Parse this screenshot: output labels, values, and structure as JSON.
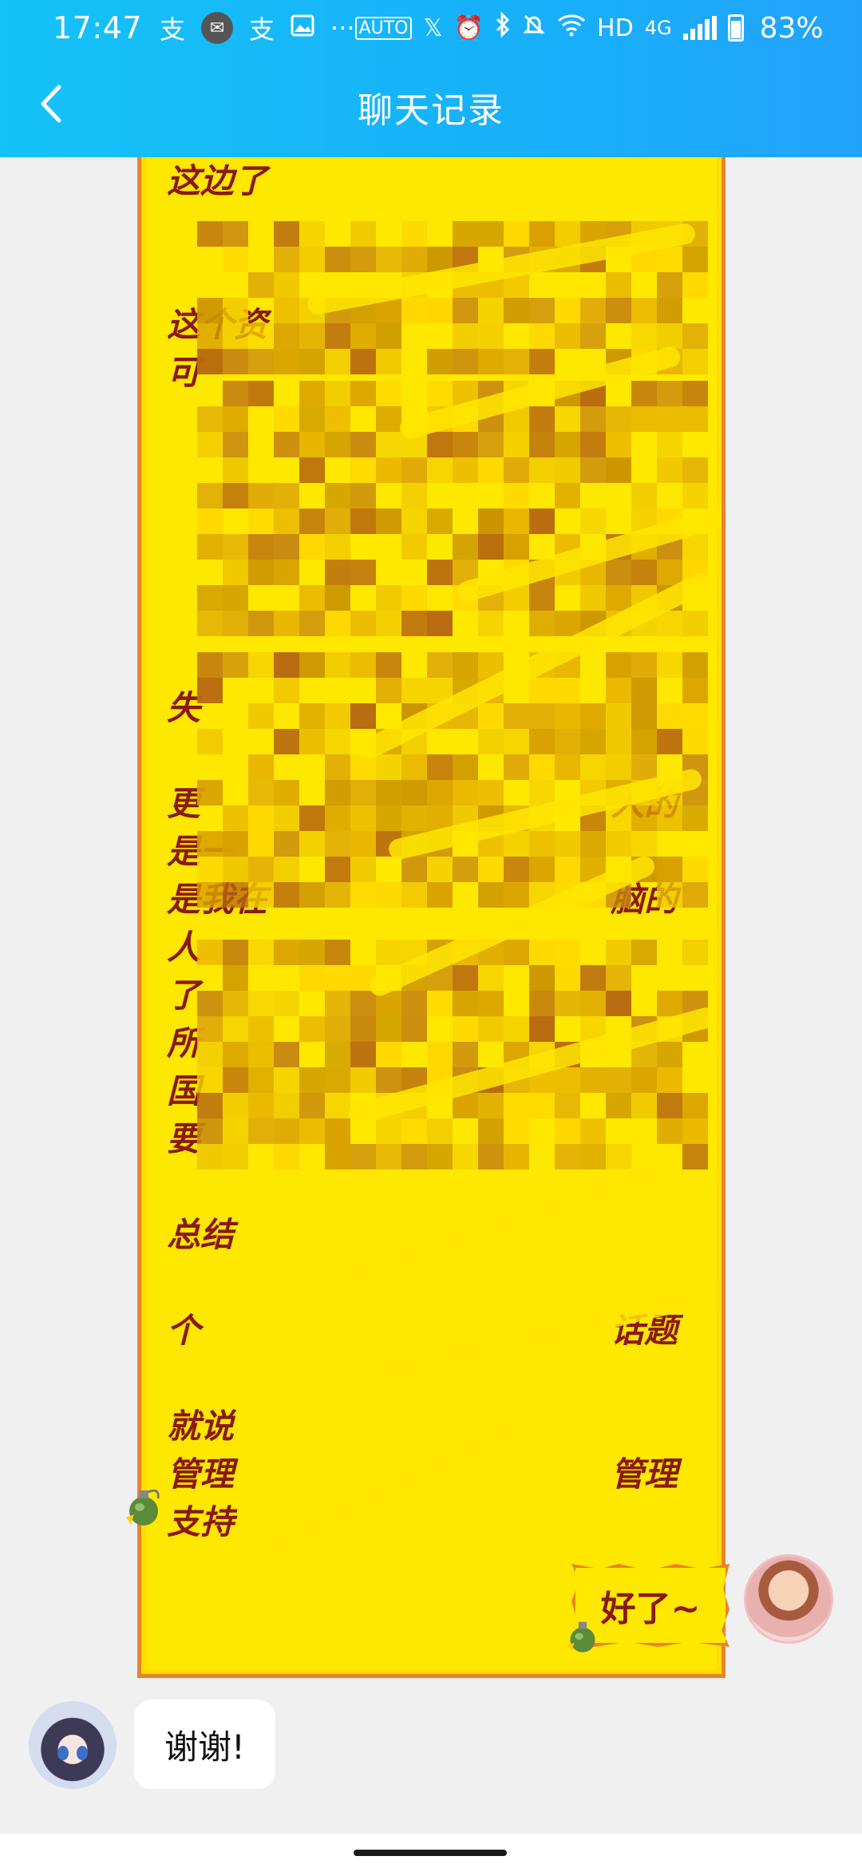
{
  "status_bar": {
    "time": "17:47",
    "left_icons": [
      "alipay-icon",
      "mail-icon",
      "alipay-icon",
      "gallery-icon",
      "more-dots-icon"
    ],
    "more_dots": "···",
    "auto_label": "AUTO",
    "hd_label": "HD",
    "network_label": "4G",
    "battery": "83%"
  },
  "titlebar": {
    "title": "聊天记录",
    "back_icon": "chevron-left-icon"
  },
  "messages": {
    "sticker_big": {
      "visible_lines": [
        "这边了",
        "",
        "",
        "这个资",
        "可",
        "",
        "",
        "",
        "",
        "",
        "",
        "失",
        "",
        "更",
        "是一",
        "是我在",
        "人",
        "了",
        "所",
        "国",
        "要",
        "",
        "总结",
        "",
        "个",
        "",
        "就说",
        "管理",
        "支持"
      ],
      "side_labels": {
        "line_13_end": "人的",
        "line_15_end": "脑的",
        "line_24_end": "话题",
        "line_27_end": "管理"
      }
    },
    "my_sticker": {
      "text": "好了~"
    },
    "reply": {
      "text": "谢谢!"
    }
  },
  "colors": {
    "header_start": "#15c3f8",
    "header_end": "#22a3fb",
    "background": "#f0f0f0",
    "sticker_yellow": "#ffe800",
    "sticker_border": "#e8842a",
    "sticker_text": "#8a1a10"
  }
}
